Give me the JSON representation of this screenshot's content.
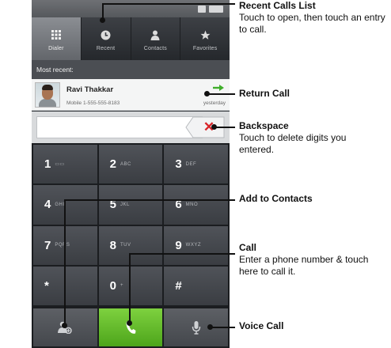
{
  "tabs": [
    {
      "label": "Dialer",
      "icon": "dialpad-icon"
    },
    {
      "label": "Recent",
      "icon": "clock-icon"
    },
    {
      "label": "Contacts",
      "icon": "person-icon"
    },
    {
      "label": "Favorites",
      "icon": "star-icon"
    }
  ],
  "recent": {
    "header": "Most recent:",
    "name": "Ravi Thakkar",
    "number": "Mobile 1-555-555-8183",
    "time": "yesterday"
  },
  "digits": {
    "value": ""
  },
  "keys": [
    {
      "main": "1",
      "sub": "▭▭"
    },
    {
      "main": "2",
      "sub": "ABC"
    },
    {
      "main": "3",
      "sub": "DEF"
    },
    {
      "main": "4",
      "sub": "GHI"
    },
    {
      "main": "5",
      "sub": "JKL"
    },
    {
      "main": "6",
      "sub": "MNO"
    },
    {
      "main": "7",
      "sub": "PQRS"
    },
    {
      "main": "8",
      "sub": "TUV"
    },
    {
      "main": "9",
      "sub": "WXYZ"
    },
    {
      "main": "*",
      "sub": ""
    },
    {
      "main": "0",
      "sub": "+"
    },
    {
      "main": "#",
      "sub": ""
    }
  ],
  "callouts": {
    "recent_calls": {
      "title": "Recent Calls List",
      "desc": "Touch to open, then touch an entry to call."
    },
    "return_call": {
      "title": "Return Call"
    },
    "backspace": {
      "title": "Backspace",
      "desc": "Touch to delete digits you entered."
    },
    "add_contacts": {
      "title": "Add to Contacts"
    },
    "call": {
      "title": "Call",
      "desc": "Enter a phone number & touch here to call it."
    },
    "voice_call": {
      "title": "Voice Call"
    }
  },
  "colors": {
    "call_green": "#5cb82a",
    "backspace_red": "#d8252a",
    "return_arrow_green": "#3fae2a"
  }
}
